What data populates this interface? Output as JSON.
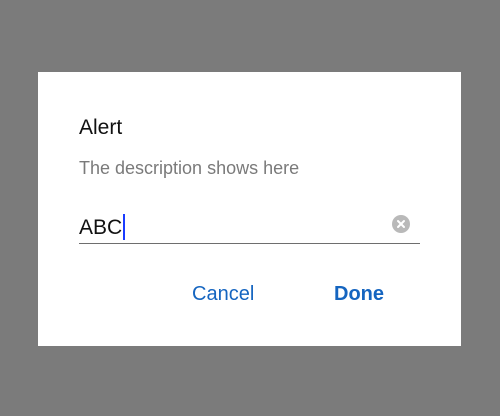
{
  "dialog": {
    "title": "Alert",
    "description": "The description shows here",
    "input": {
      "value": "ABC"
    },
    "buttons": {
      "cancel": "Cancel",
      "done": "Done"
    }
  },
  "colors": {
    "backdrop": "#7b7b7b",
    "accent": "#1565c0",
    "caret": "#1a3cff"
  },
  "icons": {
    "clear": "clear-circle-icon"
  }
}
